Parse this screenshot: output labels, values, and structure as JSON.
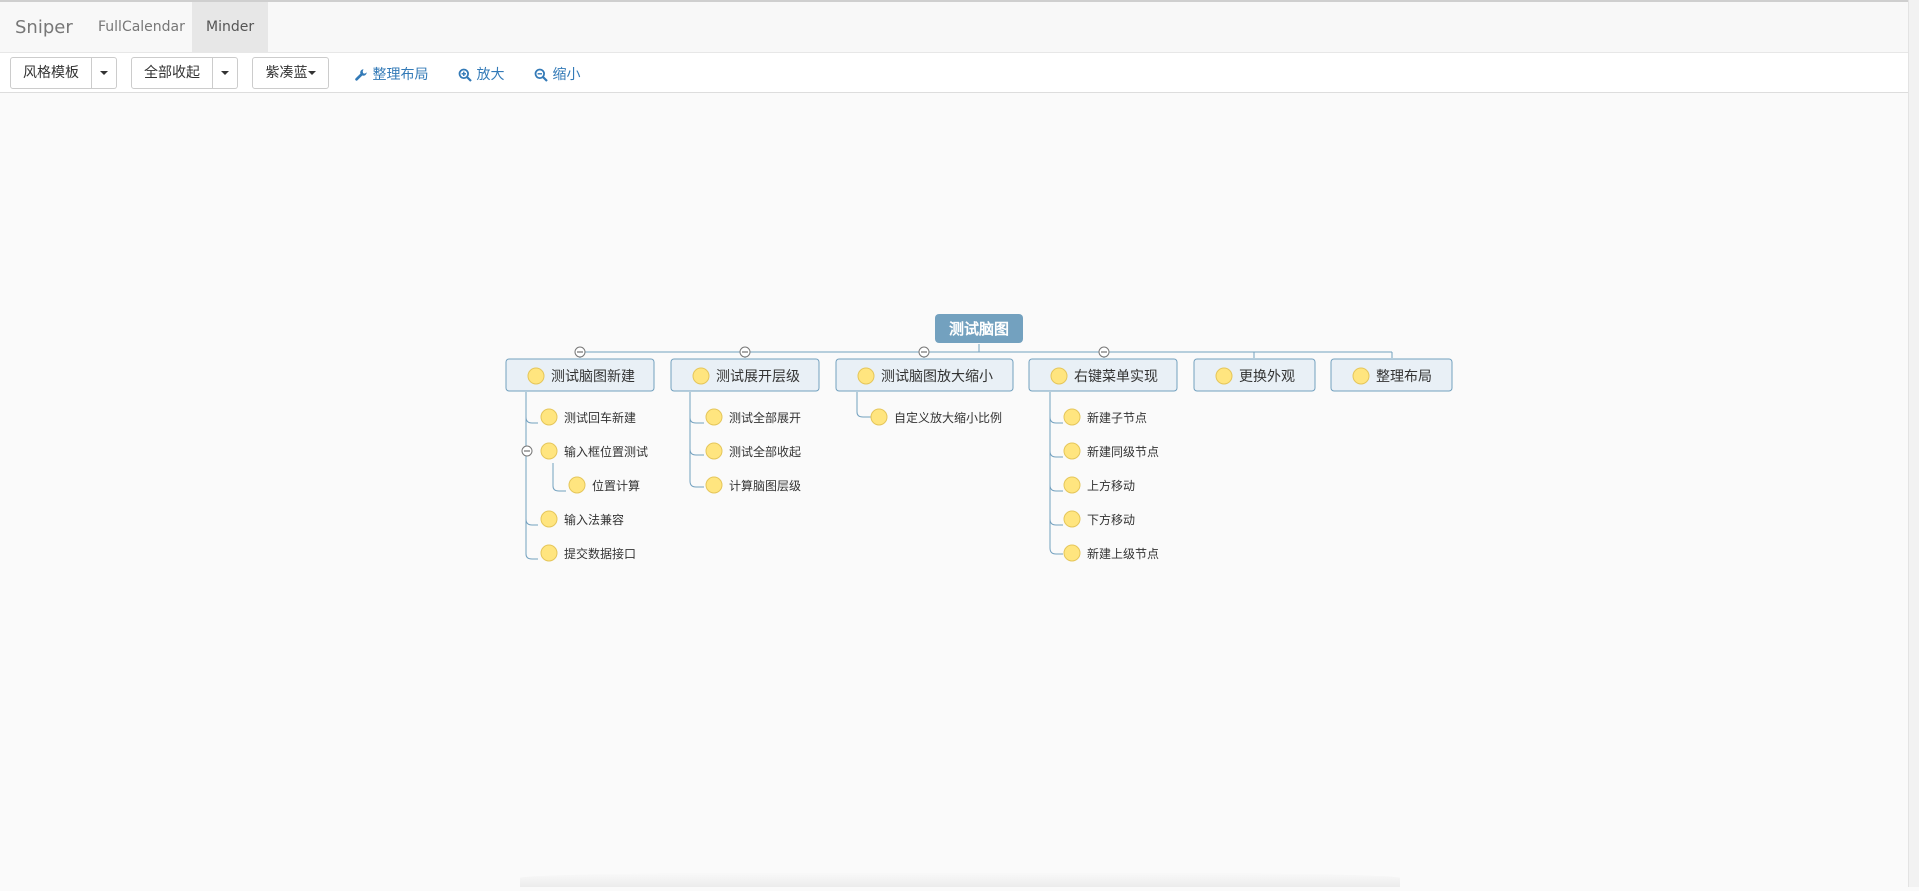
{
  "navbar": {
    "brand": "Sniper",
    "items": [
      "FullCalendar",
      "Minder"
    ],
    "active": "Minder"
  },
  "toolbar": {
    "template_label": "风格模板",
    "collapse_label": "全部收起",
    "theme_label": "紫凑蓝",
    "arrange_label": "整理布局",
    "zoom_in_label": "放大",
    "zoom_out_label": "缩小"
  },
  "mindmap": {
    "root": "测试脑图",
    "branches": [
      {
        "label": "测试脑图新建",
        "children": [
          {
            "label": "测试回车新建"
          },
          {
            "label": "输入框位置测试",
            "children": [
              {
                "label": "位置计算"
              }
            ]
          },
          {
            "label": "输入法兼容"
          },
          {
            "label": "提交数据接口"
          }
        ]
      },
      {
        "label": "测试展开层级",
        "children": [
          {
            "label": "测试全部展开"
          },
          {
            "label": "测试全部收起"
          },
          {
            "label": "计算脑图层级"
          }
        ]
      },
      {
        "label": "测试脑图放大缩小",
        "children": [
          {
            "label": "自定义放大缩小比例"
          }
        ]
      },
      {
        "label": "右键菜单实现",
        "children": [
          {
            "label": "新建子节点"
          },
          {
            "label": "新建同级节点"
          },
          {
            "label": "上方移动"
          },
          {
            "label": "下方移动"
          },
          {
            "label": "新建上级节点"
          }
        ]
      },
      {
        "label": "更换外观",
        "children": []
      },
      {
        "label": "整理布局",
        "children": []
      }
    ]
  },
  "colors": {
    "root_fill": "#73a1bf",
    "branch_fill": "#e9f0f6",
    "branch_stroke": "#73a1bf",
    "line": "#73a1bf",
    "priority_fill": "#ffe57f",
    "link": "#337ab7"
  },
  "icons": {
    "priority": "priority-circle-icon",
    "collapse": "collapse-minus-icon",
    "wrench": "wrench-icon",
    "zoom_in": "zoom-in-icon",
    "zoom_out": "zoom-out-icon"
  }
}
